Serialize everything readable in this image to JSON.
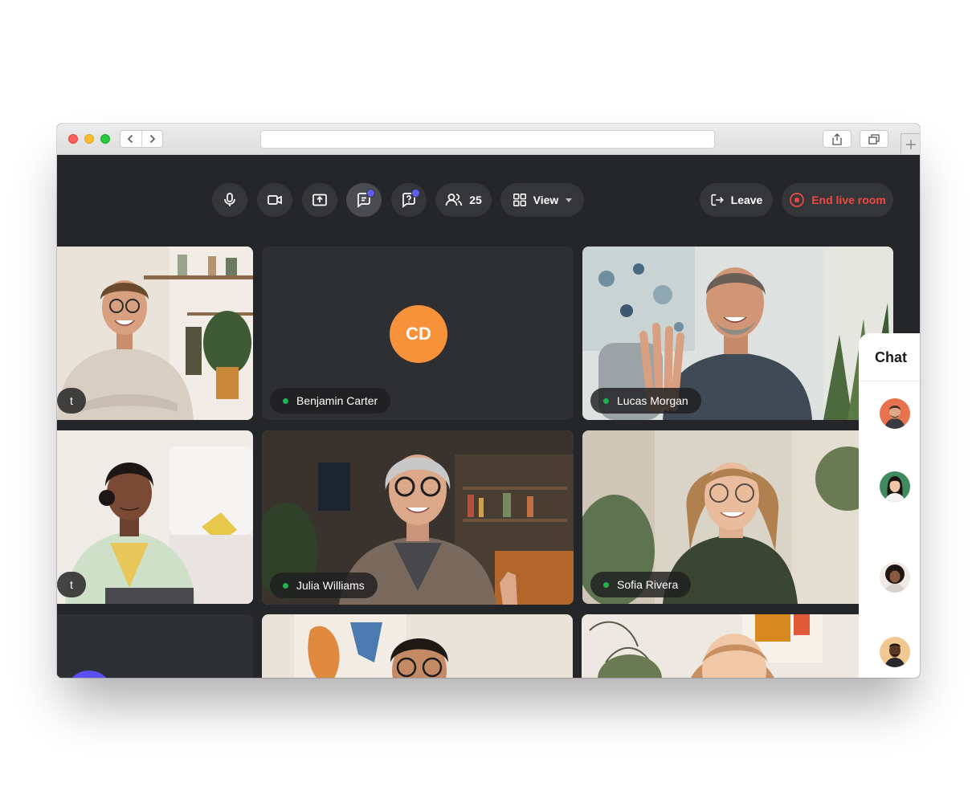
{
  "toolbar": {
    "participants_count": "25",
    "view_label": "View",
    "leave_label": "Leave",
    "end_label": "End live room"
  },
  "tiles": [
    {
      "name": "t"
    },
    {
      "name": "Benjamin Carter",
      "initials": "CD"
    },
    {
      "name": "Lucas Morgan"
    },
    {
      "name": "t"
    },
    {
      "name": "Julia Williams"
    },
    {
      "name": "Sofia Rivera"
    }
  ],
  "chat": {
    "title": "Chat"
  },
  "colors": {
    "accent": "#5b5ff5",
    "speaking": "#4fd48a",
    "end": "#ef4a41",
    "initials_bg": "#f7913a",
    "live": "#1fb24f"
  }
}
